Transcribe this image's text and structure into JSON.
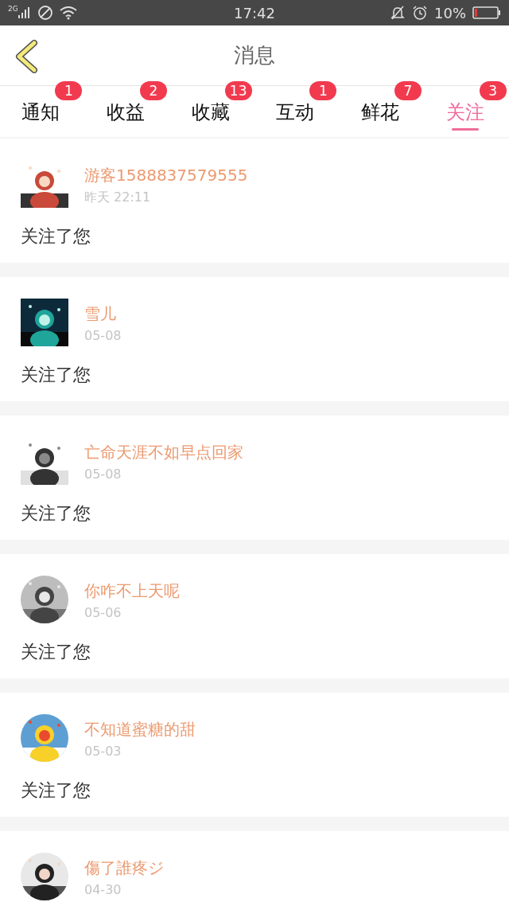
{
  "status_bar": {
    "network": "2G",
    "time": "17:42",
    "battery": "10%"
  },
  "header": {
    "title": "消息"
  },
  "tabs": [
    {
      "label": "通知",
      "badge": "1",
      "selected": false
    },
    {
      "label": "收益",
      "badge": "2",
      "selected": false
    },
    {
      "label": "收藏",
      "badge": "13",
      "selected": false
    },
    {
      "label": "互动",
      "badge": "1",
      "selected": false
    },
    {
      "label": "鲜花",
      "badge": "7",
      "selected": false
    },
    {
      "label": "关注",
      "badge": "3",
      "selected": true
    }
  ],
  "messages": [
    {
      "name": "游客1588837579555",
      "time": "昨天 22:11",
      "text": "关注了您",
      "kind": "square"
    },
    {
      "name": "雪儿",
      "time": "05-08",
      "text": "关注了您",
      "kind": "square"
    },
    {
      "name": "亡命天涯不如早点回家",
      "time": "05-08",
      "text": "关注了您",
      "kind": "square"
    },
    {
      "name": "你咋不上天呢",
      "time": "05-06",
      "text": "关注了您",
      "kind": "round"
    },
    {
      "name": "不知道蜜糖的甜",
      "time": "05-03",
      "text": "关注了您",
      "kind": "round"
    },
    {
      "name": "傷了誰疼ジ",
      "time": "04-30",
      "kind": "round"
    }
  ]
}
